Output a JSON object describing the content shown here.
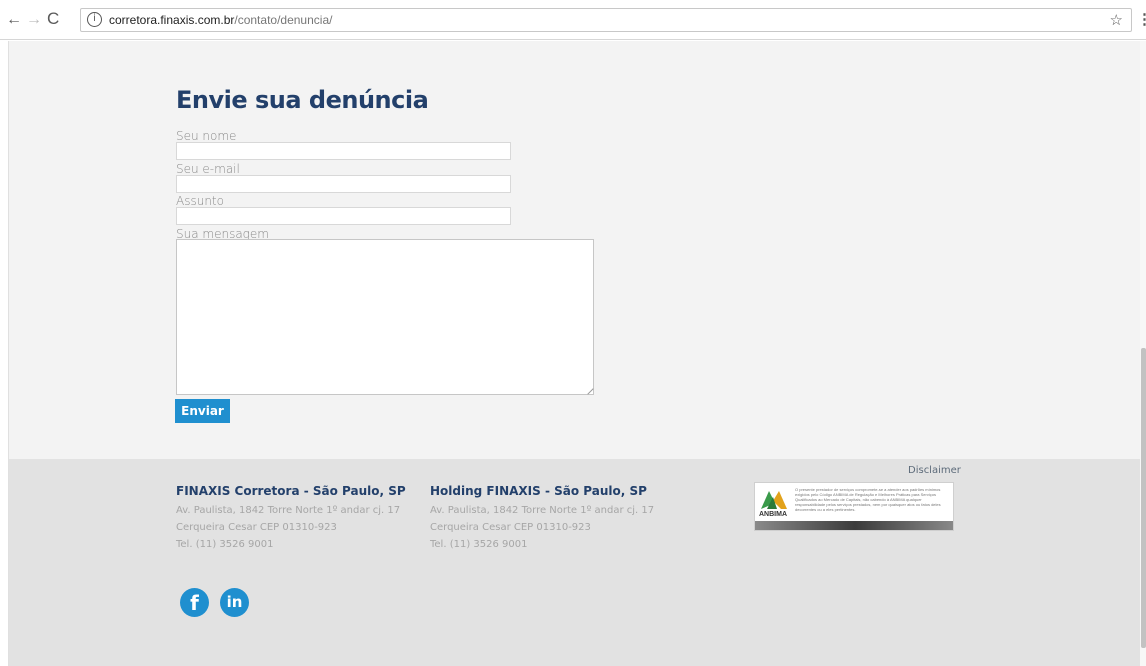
{
  "browser": {
    "back": "←",
    "forward": "→",
    "reload": "C",
    "info": "i",
    "url_host": "corretora.finaxis.com.br",
    "url_path": "/contato/denuncia/",
    "star": "☆",
    "menu": "⋮"
  },
  "form": {
    "title": "Envie sua denúncia",
    "name_label": "Seu nome",
    "email_label": "Seu e-mail",
    "subject_label": "Assunto",
    "message_label": "Sua mensagem",
    "name_value": "",
    "email_value": "",
    "subject_value": "",
    "message_value": "",
    "submit_label": "Enviar"
  },
  "footer": {
    "disclaimer": "Disclaimer",
    "offices": [
      {
        "title": "FINAXIS Corretora - São Paulo, SP",
        "lines": [
          "Av. Paulista, 1842 Torre Norte 1º andar cj. 17",
          "Cerqueira Cesar CEP 01310-923",
          "Tel. (11) 3526 9001"
        ]
      },
      {
        "title": "Holding FINAXIS - São Paulo, SP",
        "lines": [
          "Av. Paulista, 1842 Torre Norte 1º andar cj. 17",
          "Cerqueira Cesar CEP 01310-923",
          "Tel. (11) 3526 9001"
        ]
      }
    ],
    "anbima": {
      "brand": "ANBIMA",
      "text": "O presente prestador de serviços compromete-se a atender aos padrões mínimos exigidos pelo Código ANBIMA de Regulação e Melhores Práticas para Serviços Qualificados ao Mercado de Capitais, não cabendo à ANBIMA qualquer responsabilidade pelos serviços prestados, nem por quaisquer atos ou fatos deles decorrentes ou a eles pertinentes."
    },
    "social": {
      "facebook": "f",
      "linkedin": "in"
    }
  },
  "colors": {
    "title": "#23406b",
    "accent": "#1f8fcf",
    "page_bg": "#f3f3f3",
    "footer_bg": "#e2e2e2"
  }
}
